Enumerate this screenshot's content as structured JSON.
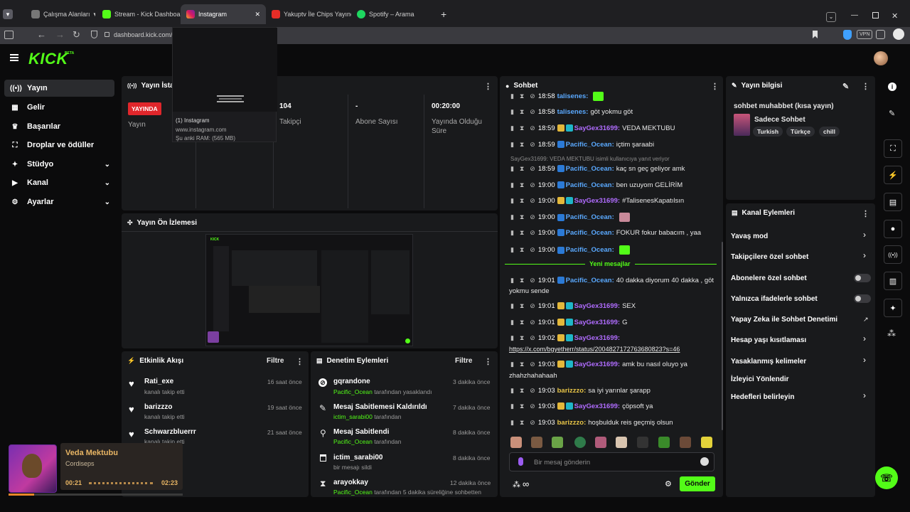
{
  "browser": {
    "tabs": [
      {
        "label": "Çalışma Alanları"
      },
      {
        "label": "Stream - Kick Dashboard"
      },
      {
        "label": "Instagram"
      },
      {
        "label": "Yakuptv İle Chips Yayında K"
      },
      {
        "label": "Spotify – Arama"
      }
    ],
    "url": "dashboard.kick.com/s",
    "vpn": "VPN",
    "tooltip": {
      "title": "(1) Instagram",
      "domain": "www.instagram.com",
      "ram": "Şu anki RAM: (565 MB)"
    }
  },
  "brand": {
    "logo": "KICK",
    "beta": "BETA",
    "accent": "#53fc18"
  },
  "nav": {
    "items": [
      {
        "label": "Yayın",
        "icon": "broadcast-icon"
      },
      {
        "label": "Gelir",
        "icon": "revenue-icon"
      },
      {
        "label": "Başarılar",
        "icon": "trophy-icon"
      },
      {
        "label": "Droplar ve ödüller",
        "icon": "gift-icon"
      },
      {
        "label": "Stüdyo",
        "icon": "studio-icon"
      },
      {
        "label": "Kanal",
        "icon": "channel-icon"
      },
      {
        "label": "Ayarlar",
        "icon": "settings-icon"
      }
    ]
  },
  "stats": {
    "title": "Yayın İstati",
    "live_badge": "YAYINDA",
    "yayin_label": "Yayın",
    "followers_value": "104",
    "followers_label": "Takipçi",
    "subs_value": "-",
    "subs_label": "Abone Sayısı",
    "duration_value": "00:20:00",
    "duration_label": "Yayında Olduğu Süre"
  },
  "preview": {
    "title": "Yayın Ön İzlemesi"
  },
  "activity": {
    "title": "Etkinlik Akışı",
    "filter": "Filtre",
    "items": [
      {
        "name": "Rati_exe",
        "sub": "kanalı takip etti",
        "time": "16 saat önce"
      },
      {
        "name": "barizzzo",
        "sub": "kanalı takip etti",
        "time": "19 saat önce"
      },
      {
        "name": "Schwarzbluerrr",
        "sub": "kanalı takip etti",
        "time": "21 saat önce"
      }
    ]
  },
  "moderation": {
    "title": "Denetim Eylemleri",
    "filter": "Filtre",
    "items": [
      {
        "name": "gqrandone",
        "actor": "Pacific_Ocean",
        "rest": "tarafından yasaklandı",
        "time": "3 dakika önce"
      },
      {
        "name": "Mesaj Sabitlemesi Kaldırıldı",
        "actor": "ictim_sarabi00",
        "rest": "tarafından",
        "time": "7 dakika önce"
      },
      {
        "name": "Mesaj Sabitlendi",
        "actor": "Pacific_Ocean",
        "rest": "tarafından",
        "time": "8 dakika önce"
      },
      {
        "name": "ictim_sarabi00",
        "actor": "",
        "rest": "bir mesajı sildi",
        "time": "8 dakika önce"
      },
      {
        "name": "arayokkay",
        "actor": "Pacific_Ocean",
        "rest": "tarafından 5 dakika süreliğine sohbetten",
        "time": "12 dakika önce"
      }
    ]
  },
  "chat": {
    "title": "Sohbet",
    "new_messages": "Yeni mesajlar",
    "reply_notice": "SayGex31699: VEDA MEKTUBU isimli kullanıcıya yanıt veriyor",
    "messages": [
      {
        "time": "18:58",
        "user": "talisenes:",
        "text": "",
        "color": "#5aa9ff"
      },
      {
        "time": "18:58",
        "user": "talisenes:",
        "text": "göt yokmu göt",
        "color": "#5aa9ff"
      },
      {
        "time": "18:59",
        "user": "SayGex31699:",
        "text": "VEDA MEKTUBU",
        "color": "#b06cff"
      },
      {
        "time": "18:59",
        "user": "Pacific_Ocean:",
        "text": "içtim şaraabi",
        "color": "#5aa9ff"
      },
      {
        "time": "18:59",
        "user": "Pacific_Ocean:",
        "text": "kaç sn geç geliyor amk",
        "color": "#5aa9ff"
      },
      {
        "time": "19:00",
        "user": "Pacific_Ocean:",
        "text": "ben uzuyom GELİRİM",
        "color": "#5aa9ff"
      },
      {
        "time": "19:00",
        "user": "SayGex31699:",
        "text": "#TalisenesKapatılsın",
        "color": "#b06cff"
      },
      {
        "time": "19:00",
        "user": "Pacific_Ocean:",
        "text": "",
        "color": "#5aa9ff"
      },
      {
        "time": "19:00",
        "user": "Pacific_Ocean:",
        "text": "FOKUR fokur babacım , yaa",
        "color": "#5aa9ff"
      },
      {
        "time": "19:00",
        "user": "Pacific_Ocean:",
        "text": "",
        "color": "#5aa9ff"
      },
      {
        "time": "19:01",
        "user": "Pacific_Ocean:",
        "text": "40 dakka diyorum 40 dakka , göt",
        "color": "#5aa9ff"
      },
      {
        "time": "19:01",
        "user": "SayGex31699:",
        "text": "SEX",
        "color": "#b06cff"
      },
      {
        "time": "19:01",
        "user": "SayGex31699:",
        "text": "G",
        "color": "#b06cff"
      },
      {
        "time": "19:02",
        "user": "SayGex31699:",
        "text": "",
        "color": "#b06cff"
      },
      {
        "time": "19:03",
        "user": "SayGex31699:",
        "text": "amk bu nasıl oluyo ya",
        "color": "#b06cff"
      },
      {
        "time": "19:03",
        "user": "barizzzo:",
        "text": "sa iyi yarınlar şarapp",
        "color": "#e8c547"
      },
      {
        "time": "19:03",
        "user": "SayGex31699:",
        "text": "çöpsoft ya",
        "color": "#b06cff"
      },
      {
        "time": "19:03",
        "user": "barizzzo:",
        "text": "hoşbulduk reis geçmiş olsun",
        "color": "#e8c547"
      }
    ],
    "wrap_1": "yokmu sende",
    "link": "https://x.com/bgyetherr/status/2004827172763680823?s=46",
    "wrap_2": "zhahzhahahaah",
    "input_placeholder": "Bir mesaj gönderin",
    "send": "Gönder"
  },
  "stream_info": {
    "title": "Yayın bilgisi",
    "stream_title": "sohbet muhabbet (kısa yayın)",
    "category": "Sadece Sohbet",
    "tags": [
      "Turkish",
      "Türkçe",
      "chill"
    ]
  },
  "channel_actions": {
    "title": "Kanal Eylemleri",
    "rows": [
      {
        "label": "Yavaş mod"
      },
      {
        "label": "Takipçilere özel sohbet"
      },
      {
        "label": "Abonelere özel sohbet"
      },
      {
        "label": "Yalnızca ifadelerle sohbet"
      },
      {
        "label": "Yapay Zeka ile Sohbet Denetimi"
      },
      {
        "label": "Hesap yaşı kısıtlaması"
      },
      {
        "label": "Yasaklanmış kelimeler"
      },
      {
        "label": "İzleyici Yönlendir"
      },
      {
        "label": "Hedefleri belirleyin"
      }
    ]
  },
  "player": {
    "title": "Veda Mektubu",
    "artist": "Cordiseps",
    "elapsed": "00:21",
    "total": "02:23",
    "progress": 0.147
  }
}
